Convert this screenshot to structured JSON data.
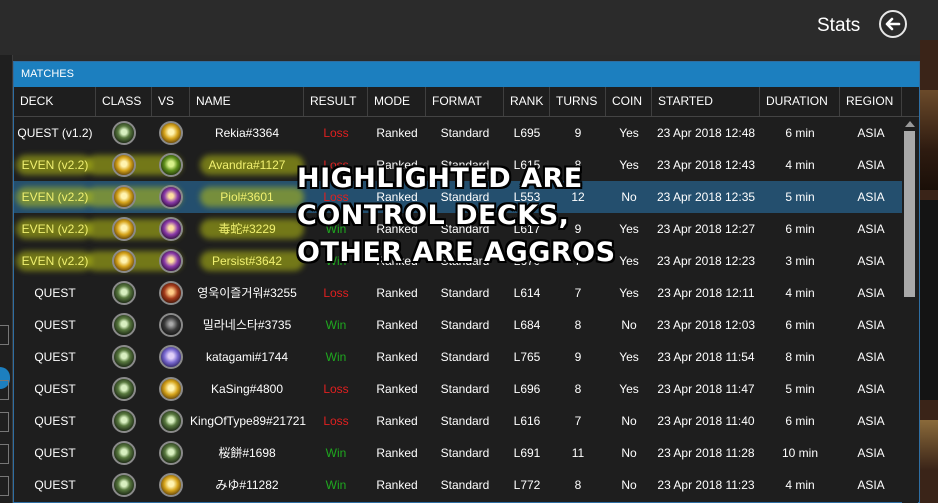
{
  "header": {
    "title": "Stats"
  },
  "panel": {
    "title": "MATCHES"
  },
  "columns": [
    "DECK",
    "CLASS",
    "VS",
    "NAME",
    "RESULT",
    "MODE",
    "FORMAT",
    "RANK",
    "TURNS",
    "COIN",
    "STARTED",
    "DURATION",
    "REGION"
  ],
  "colors": {
    "accent": "#1c7fbf",
    "loss": "#e02020",
    "win": "#1fa81f",
    "highlight": "#b9c21d",
    "selected": "#244f6e"
  },
  "overlay_text": [
    "HIGHLIGHTED ARE",
    "CONTROL DECKS,",
    "OTHER ARE AGGROS"
  ],
  "rows": [
    {
      "deck": "QUEST (v1.2)",
      "class_icon": "druid-icon",
      "vs_icon": "paladin-icon",
      "name": "Rekia#3364",
      "result": "Loss",
      "mode": "Ranked",
      "format": "Standard",
      "rank": "L695",
      "turns": "9",
      "coin": "Yes",
      "started": "23 Apr 2018 12:48",
      "duration": "6 min",
      "region": "ASIA",
      "highlight": false
    },
    {
      "deck": "EVEN (v2.2)",
      "class_icon": "paladin-icon",
      "vs_icon": "hunter-icon",
      "name": "Avandra#1127",
      "result": "Loss",
      "mode": "Ranked",
      "format": "Standard",
      "rank": "L615",
      "turns": "8",
      "coin": "Yes",
      "started": "23 Apr 2018 12:43",
      "duration": "4 min",
      "region": "ASIA",
      "highlight": true
    },
    {
      "deck": "EVEN (v2.2)",
      "class_icon": "paladin-icon",
      "vs_icon": "warlock-icon",
      "name": "Piol#3601",
      "result": "Loss",
      "mode": "Ranked",
      "format": "Standard",
      "rank": "L553",
      "turns": "12",
      "coin": "No",
      "started": "23 Apr 2018 12:35",
      "duration": "5 min",
      "region": "ASIA",
      "highlight": true,
      "selected": true
    },
    {
      "deck": "EVEN (v2.2)",
      "class_icon": "paladin-icon",
      "vs_icon": "warlock-icon",
      "name": "毒蛇#3229",
      "result": "Win",
      "mode": "Ranked",
      "format": "Standard",
      "rank": "L617",
      "turns": "9",
      "coin": "Yes",
      "started": "23 Apr 2018 12:27",
      "duration": "6 min",
      "region": "ASIA",
      "highlight": true
    },
    {
      "deck": "EVEN (v2.2)",
      "class_icon": "paladin-icon",
      "vs_icon": "warlock-icon",
      "name": "Persist#3642",
      "result": "Win",
      "mode": "Ranked",
      "format": "Standard",
      "rank": "L670",
      "turns": "7",
      "coin": "Yes",
      "started": "23 Apr 2018 12:23",
      "duration": "3 min",
      "region": "ASIA",
      "highlight": true
    },
    {
      "deck": "QUEST",
      "class_icon": "druid-icon",
      "vs_icon": "warrior-icon",
      "name": "영욱이즐거워#3255",
      "result": "Loss",
      "mode": "Ranked",
      "format": "Standard",
      "rank": "L614",
      "turns": "7",
      "coin": "Yes",
      "started": "23 Apr 2018 12:11",
      "duration": "4 min",
      "region": "ASIA",
      "highlight": false
    },
    {
      "deck": "QUEST",
      "class_icon": "druid-icon",
      "vs_icon": "rogue-icon",
      "name": "밀라네스타#3735",
      "result": "Win",
      "mode": "Ranked",
      "format": "Standard",
      "rank": "L684",
      "turns": "8",
      "coin": "No",
      "started": "23 Apr 2018 12:03",
      "duration": "6 min",
      "region": "ASIA",
      "highlight": false
    },
    {
      "deck": "QUEST",
      "class_icon": "druid-icon",
      "vs_icon": "mage-icon",
      "name": "katagami#1744",
      "result": "Win",
      "mode": "Ranked",
      "format": "Standard",
      "rank": "L765",
      "turns": "9",
      "coin": "Yes",
      "started": "23 Apr 2018 11:54",
      "duration": "8 min",
      "region": "ASIA",
      "highlight": false
    },
    {
      "deck": "QUEST",
      "class_icon": "druid-icon",
      "vs_icon": "paladin-icon",
      "name": "KaSing#4800",
      "result": "Loss",
      "mode": "Ranked",
      "format": "Standard",
      "rank": "L696",
      "turns": "8",
      "coin": "Yes",
      "started": "23 Apr 2018 11:47",
      "duration": "5 min",
      "region": "ASIA",
      "highlight": false
    },
    {
      "deck": "QUEST",
      "class_icon": "druid-icon",
      "vs_icon": "druid-icon",
      "name": "KingOfType89#21721",
      "result": "Loss",
      "mode": "Ranked",
      "format": "Standard",
      "rank": "L616",
      "turns": "7",
      "coin": "No",
      "started": "23 Apr 2018 11:40",
      "duration": "6 min",
      "region": "ASIA",
      "highlight": false
    },
    {
      "deck": "QUEST",
      "class_icon": "druid-icon",
      "vs_icon": "druid-icon",
      "name": "桜餅#1698",
      "result": "Win",
      "mode": "Ranked",
      "format": "Standard",
      "rank": "L691",
      "turns": "11",
      "coin": "No",
      "started": "23 Apr 2018 11:28",
      "duration": "10 min",
      "region": "ASIA",
      "highlight": false
    },
    {
      "deck": "QUEST",
      "class_icon": "druid-icon",
      "vs_icon": "paladin-icon",
      "name": "みゆ#11282",
      "result": "Win",
      "mode": "Ranked",
      "format": "Standard",
      "rank": "L772",
      "turns": "8",
      "coin": "No",
      "started": "23 Apr 2018 11:23",
      "duration": "4 min",
      "region": "ASIA",
      "highlight": false
    }
  ]
}
